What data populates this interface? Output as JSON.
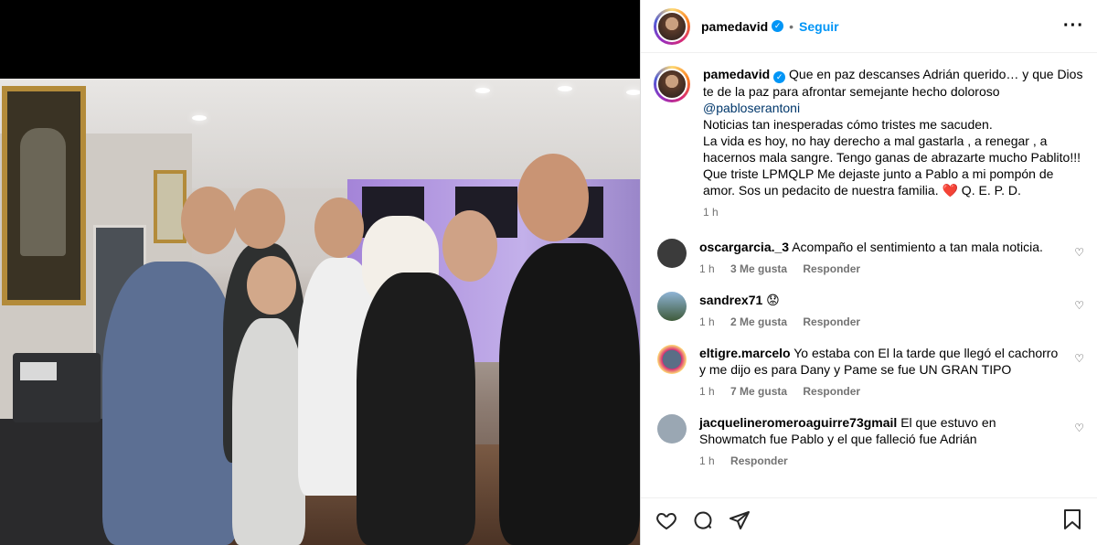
{
  "post": {
    "username": "pamedavid",
    "follow_label": "Seguir",
    "separator": "•",
    "more": "···"
  },
  "caption": {
    "username": "pamedavid",
    "text1": "Que en paz descanses Adrián querido… y que Dios te de la paz para afrontar semejante hecho doloroso ",
    "mention": "@pabloserantoni",
    "text2": "Noticias tan inesperadas cómo tristes me sacuden.\nLa vida es hoy, no hay derecho a mal gastarla , a renegar , a hacernos mala sangre. Tengo ganas de abrazarte mucho Pablito!!! Que triste LPMQLP Me dejaste junto a Pablo a mi pompón de amor. Sos un pedacito de nuestra familia. ",
    "emoji": "❤️",
    "text3": " Q. E. P. D.",
    "time": "1 h"
  },
  "comments": [
    {
      "username": "oscargarcia._3",
      "text": "Acompaño el sentimiento a tan mala noticia.",
      "time": "1 h",
      "likes": "3 Me gusta",
      "reply": "Responder",
      "avatar_color": "#3b3b3b"
    },
    {
      "username": "sandrex71",
      "text": "😟",
      "time": "1 h",
      "likes": "2 Me gusta",
      "reply": "Responder",
      "avatar_color": "#6a8fb0"
    },
    {
      "username": "eltigre.marcelo",
      "text": "Yo estaba con El la tarde que llegó el cachorro y me dijo es para Dany y Pame se fue UN GRAN TIPO",
      "time": "1 h",
      "likes": "7 Me gusta",
      "reply": "Responder",
      "avatar_color": "#5a6e86"
    },
    {
      "username": "jacquelineromeroaguirre73gmail",
      "text": "El que estuvo en Showmatch fue Pablo y el que falleció fue Adrián",
      "time": "1 h",
      "likes": "",
      "reply": "Responder",
      "avatar_color": "#9aa7b3"
    }
  ],
  "icons": {
    "like": "heart-icon",
    "comment": "comment-icon",
    "share": "share-icon",
    "save": "bookmark-icon"
  },
  "colors": {
    "accent": "#0095f6",
    "verified": "#0095f6",
    "mention": "#00376b",
    "muted": "#737373"
  }
}
